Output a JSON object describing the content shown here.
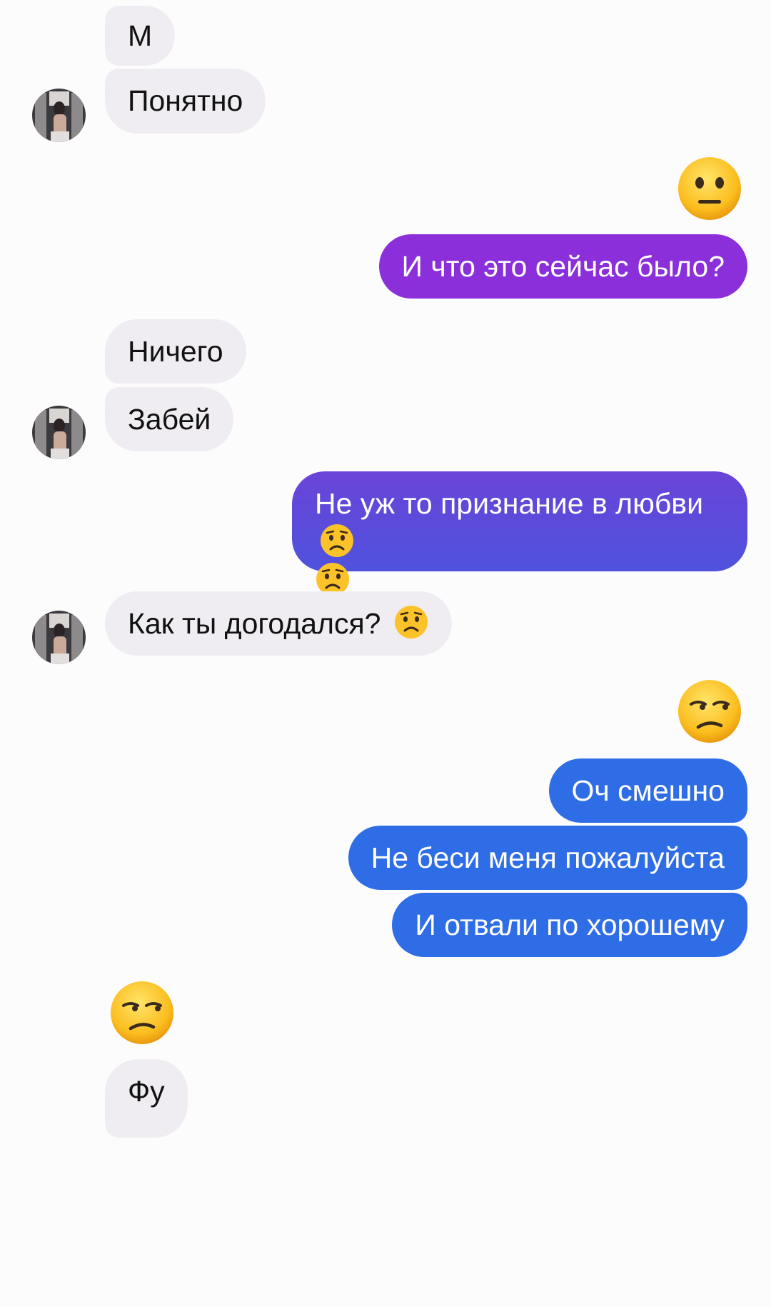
{
  "conversation": {
    "messages": [
      {
        "id": "m1",
        "direction": "incoming",
        "text": "М"
      },
      {
        "id": "m2",
        "direction": "incoming",
        "text": "Понятно"
      },
      {
        "id": "m3",
        "direction": "outgoing",
        "emoji": "neutral-face-emoji"
      },
      {
        "id": "m4",
        "direction": "outgoing",
        "text": "И что это сейчас было?"
      },
      {
        "id": "m5",
        "direction": "incoming",
        "text": "Ничего"
      },
      {
        "id": "m6",
        "direction": "incoming",
        "text": "Забей"
      },
      {
        "id": "m7",
        "direction": "outgoing",
        "text": "Не уж то признание в любви",
        "emoji": "worried-face-emoji"
      },
      {
        "id": "m8",
        "direction": "incoming",
        "text": "Как ты догодался?",
        "emoji": "worried-face-emoji"
      },
      {
        "id": "m9",
        "direction": "outgoing",
        "emoji": "unamused-face-emoji"
      },
      {
        "id": "m10",
        "direction": "outgoing",
        "text": "Оч смешно"
      },
      {
        "id": "m11",
        "direction": "outgoing",
        "text": "Не беси меня пожалуйста"
      },
      {
        "id": "m12",
        "direction": "outgoing",
        "text": "И отвали по хорошему"
      },
      {
        "id": "m13",
        "direction": "incoming",
        "emoji": "unamused-face-emoji"
      },
      {
        "id": "m14",
        "direction": "incoming",
        "text": "Фу"
      }
    ]
  },
  "colors": {
    "incoming_bubble": "#efedf1",
    "outgoing_purple": "#8a2fd9",
    "outgoing_violet": "#5b4bd8",
    "outgoing_blue": "#2f6de6",
    "background": "#fdfcfd"
  }
}
